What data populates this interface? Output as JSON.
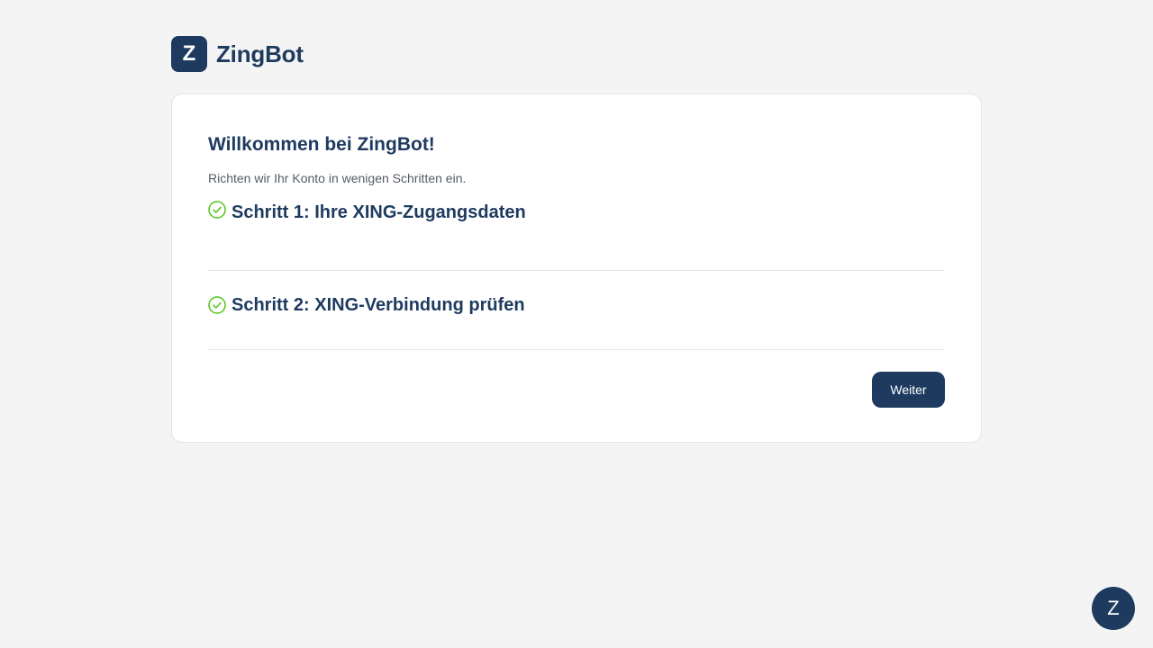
{
  "brand": {
    "logo_letter": "Z",
    "name": "ZingBot"
  },
  "card": {
    "title": "Willkommen bei ZingBot!",
    "subtitle": "Richten wir Ihr Konto in wenigen Schritten ein.",
    "steps": [
      {
        "title": "Schritt 1: Ihre XING-Zugangsdaten",
        "status_icon": "check-circle-icon",
        "status": "completed"
      },
      {
        "title": "Schritt 2: XING-Verbindung prüfen",
        "status_icon": "check-circle-icon",
        "status": "completed"
      }
    ],
    "next_label": "Weiter"
  },
  "chat_launcher": {
    "label": "Z"
  },
  "colors": {
    "primary": "#1e3a5f",
    "success": "#52c41a",
    "background": "#f4f4f4"
  }
}
